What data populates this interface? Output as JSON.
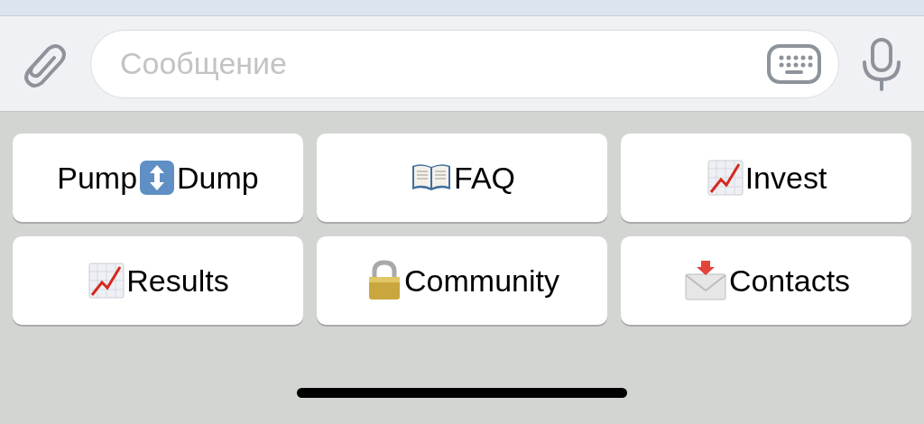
{
  "input_bar": {
    "placeholder": "Сообщение"
  },
  "keyboard": {
    "rows": [
      [
        {
          "before": "Pump",
          "kind": "updown",
          "label": "Dump"
        },
        {
          "kind": "book",
          "label": "FAQ"
        },
        {
          "kind": "chart",
          "label": "Invest"
        }
      ],
      [
        {
          "kind": "chart",
          "label": "Results"
        },
        {
          "kind": "lock",
          "label": "Community"
        },
        {
          "kind": "envelope",
          "label": "Contacts"
        }
      ]
    ]
  }
}
